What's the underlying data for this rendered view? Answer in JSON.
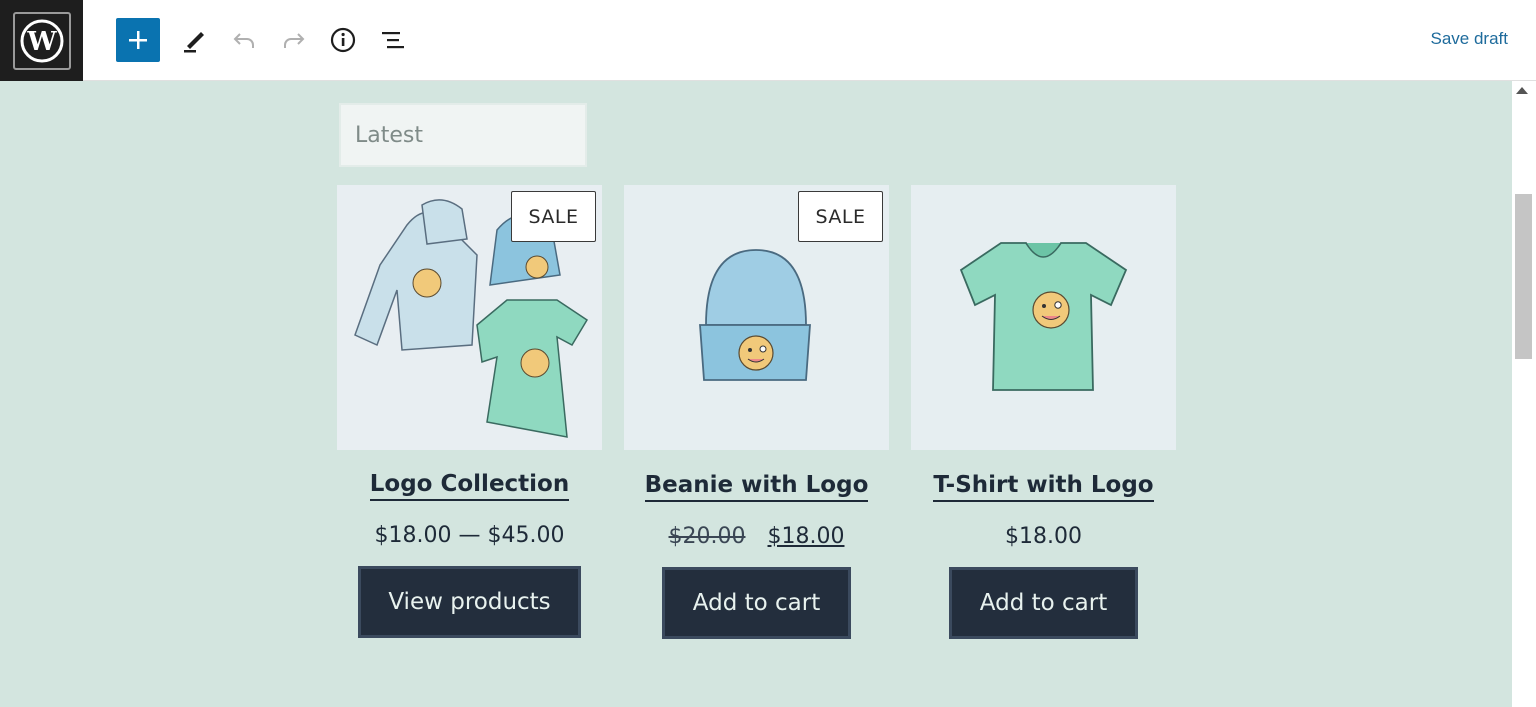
{
  "toolbar": {
    "logo_icon": "wordpress-logo-icon",
    "add_icon": "plus-icon",
    "edit_icon": "pencil-icon",
    "undo_icon": "undo-icon",
    "redo_icon": "redo-icon",
    "info_icon": "info-icon",
    "list_icon": "list-view-icon",
    "save_draft_label": "Save draft",
    "accent": "#0a73b0"
  },
  "main": {
    "sort_value": "Latest",
    "background": "#d3e5df",
    "products": [
      {
        "title": "Logo Collection",
        "sale_badge": "SALE",
        "price": "$18.00 — $45.00",
        "button_label": "View products"
      },
      {
        "title": "Beanie with Logo",
        "sale_badge": "SALE",
        "price_old": "$20.00",
        "price_new": "$18.00",
        "button_label": "Add to cart"
      },
      {
        "title": "T-Shirt with Logo",
        "price": "$18.00",
        "button_label": "Add to cart"
      }
    ]
  }
}
